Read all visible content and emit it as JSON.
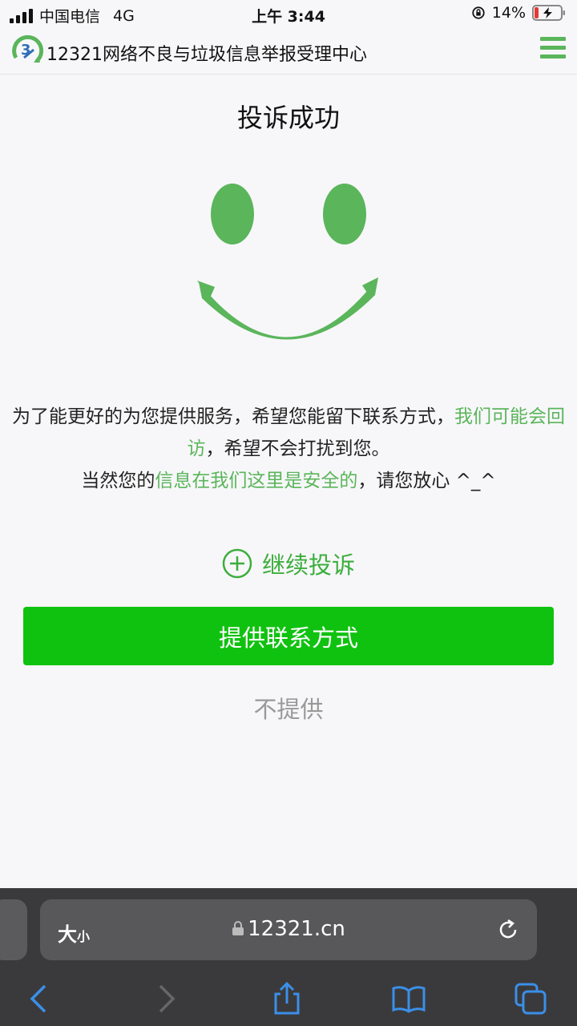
{
  "status_bar": {
    "carrier": "中国电信",
    "network": "4G",
    "time": "上午 3:44",
    "battery_percent": "14%"
  },
  "header": {
    "title": "12321网络不良与垃圾信息举报受理中心"
  },
  "main": {
    "title": "投诉成功",
    "message_part1": "为了能更好的为您提供服务，希望您能留下联系方式，",
    "message_highlight1": "我们可能会回访",
    "message_part2": "，希望不会打扰到您。",
    "message_part3": "当然您的",
    "message_highlight2": "信息在我们这里是安全的",
    "message_part4": "，请您放心 ^_^",
    "continue_label": "继续投诉",
    "provide_button": "提供联系方式",
    "decline_label": "不提供"
  },
  "browser": {
    "text_size_big": "大",
    "text_size_small": "小",
    "url": "12321.cn"
  },
  "colors": {
    "accent_green": "#5bb55b",
    "button_green": "#10c210",
    "browser_dark": "#3a3a3c",
    "toolbar_blue": "#3b8fe8"
  }
}
